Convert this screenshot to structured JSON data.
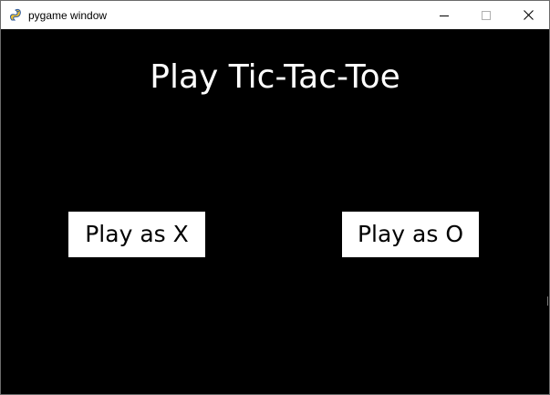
{
  "window": {
    "title": "pygame window",
    "app_icon": "pygame-snake-icon",
    "controls": {
      "minimize": "minimize-icon",
      "maximize": "maximize-icon",
      "close": "close-icon"
    }
  },
  "game": {
    "title": "Play Tic-Tac-Toe",
    "buttons": {
      "play_x": "Play as X",
      "play_o": "Play as O"
    }
  },
  "colors": {
    "background": "#000000",
    "text": "#ffffff",
    "button_bg": "#ffffff",
    "button_text": "#000000",
    "titlebar": "#ffffff"
  }
}
